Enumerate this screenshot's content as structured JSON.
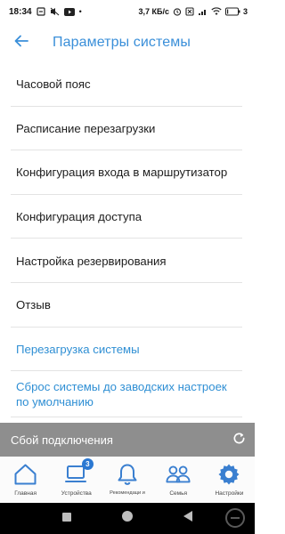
{
  "status_bar": {
    "time": "18:34",
    "speed": "3,7 КБ/с",
    "battery": "3"
  },
  "header": {
    "title": "Параметры системы"
  },
  "settings": {
    "items": [
      {
        "label": "Часовой пояс"
      },
      {
        "label": "Расписание перезагрузки"
      },
      {
        "label": "Конфигурация входа в маршрутизатор"
      },
      {
        "label": "Конфигурация доступа"
      },
      {
        "label": "Настройка резервирования"
      },
      {
        "label": "Отзыв"
      },
      {
        "label": "Перезагрузка системы"
      },
      {
        "label": "Сброс системы до заводских настроек по умолчанию"
      }
    ]
  },
  "banner": {
    "text": "Сбой подключения"
  },
  "bottom_nav": {
    "items": [
      {
        "label": "Главная",
        "icon": "home-icon"
      },
      {
        "label": "Устройства",
        "icon": "devices-icon",
        "badge": "3"
      },
      {
        "label": "Рекомендаци и",
        "icon": "bell-icon"
      },
      {
        "label": "Семья",
        "icon": "family-icon"
      },
      {
        "label": "Настройки",
        "icon": "gear-icon"
      }
    ]
  },
  "colors": {
    "accent": "#3a8fd9",
    "link": "#2f8fd4",
    "banner": "#8e8e8e",
    "nav_icon": "#3a7fd0"
  }
}
